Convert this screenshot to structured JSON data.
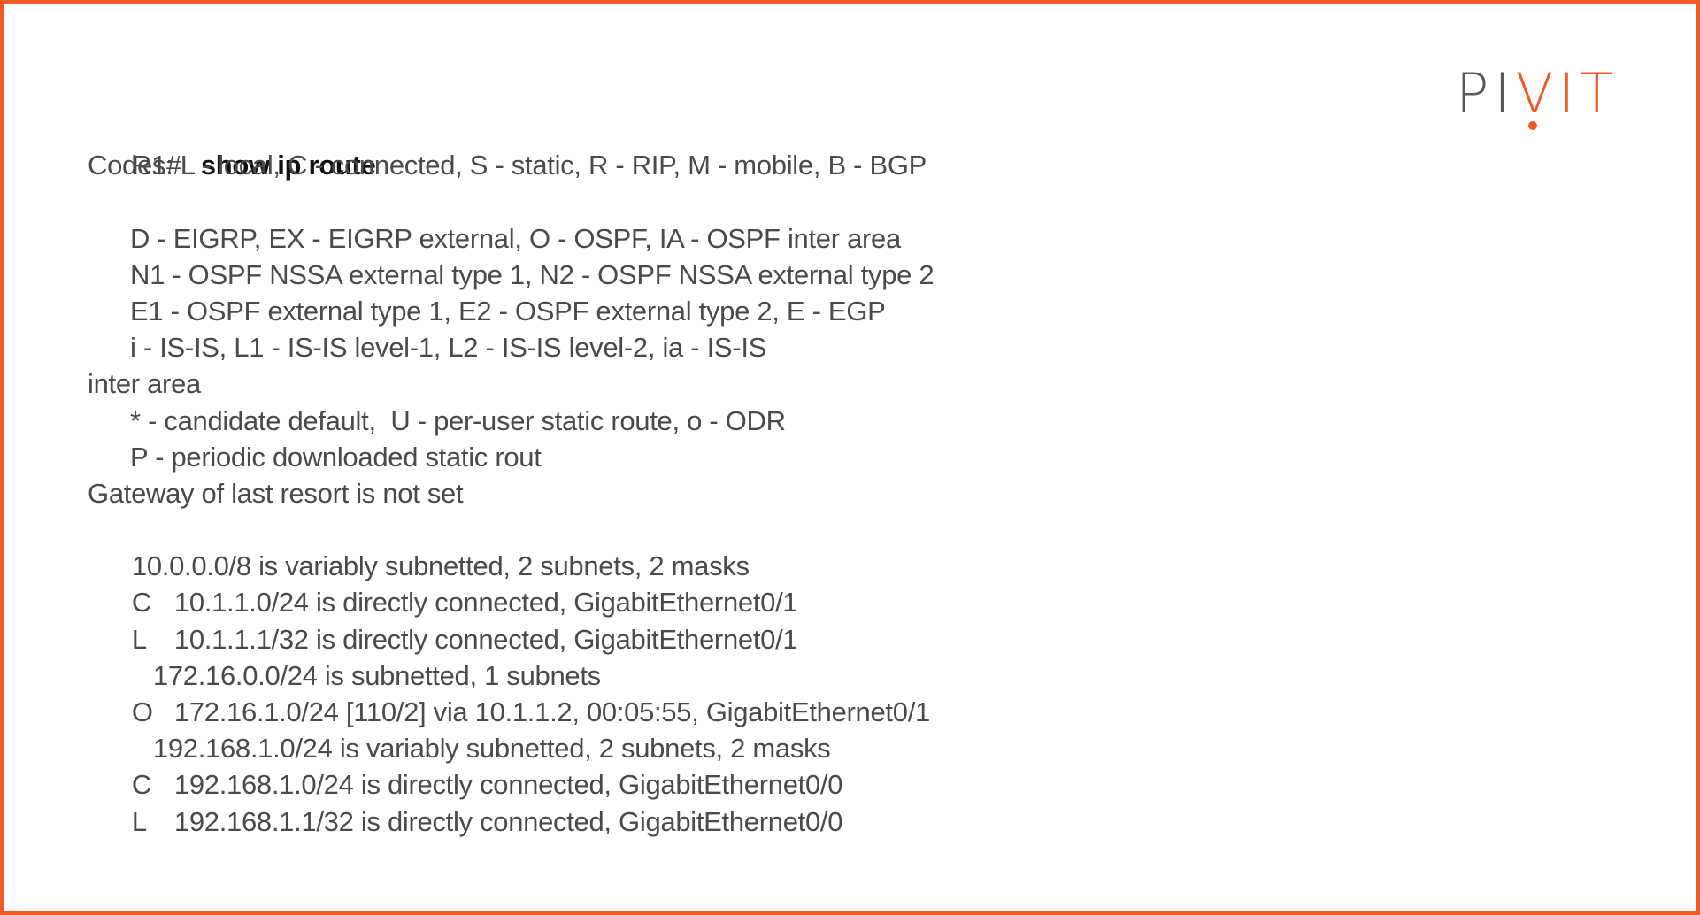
{
  "brand": {
    "logo_left": "PI",
    "logo_v": "V",
    "logo_right": "IT",
    "border_color": "#f05a28",
    "accent_color": "#f05a28",
    "logo_gray": "#58585a"
  },
  "terminal": {
    "prompt": "R1#",
    "command": "show ip route",
    "codes_header": "Codes: L - local, C - connected, S - static, R - RIP, M - mobile, B - BGP",
    "codes_lines": [
      "D - EIGRP, EX - EIGRP external, O - OSPF, IA - OSPF inter area",
      "N1 - OSPF NSSA external type 1, N2 - OSPF NSSA external type 2",
      "E1 - OSPF external type 1, E2 - OSPF external type 2, E - EGP",
      "i - IS-IS, L1 - IS-IS level-1, L2 - IS-IS level-2, ia - IS-IS"
    ],
    "codes_wrap": "inter area",
    "codes_lines_2": [
      "* - candidate default,  U - per-user static route, o - ODR",
      "P - periodic downloaded static rout"
    ],
    "gateway": "Gateway of last resort is not set",
    "routes": [
      {
        "code": "",
        "text": "10.0.0.0/8 is variably subnetted, 2 subnets, 2 masks",
        "indent": "none"
      },
      {
        "code": "C",
        "text": "10.1.1.0/24 is directly connected, GigabitEthernet0/1",
        "indent": "none"
      },
      {
        "code": "L",
        "text": "10.1.1.1/32 is directly connected, GigabitEthernet0/1",
        "indent": "none"
      },
      {
        "code": "",
        "text": "172.16.0.0/24 is subnetted, 1 subnets",
        "indent": "small"
      },
      {
        "code": "O",
        "text": "172.16.1.0/24 [110/2] via 10.1.1.2, 00:05:55, GigabitEthernet0/1",
        "indent": "none"
      },
      {
        "code": "",
        "text": "192.168.1.0/24 is variably subnetted, 2 subnets, 2 masks",
        "indent": "small"
      },
      {
        "code": "C",
        "text": "192.168.1.0/24 is directly connected, GigabitEthernet0/0",
        "indent": "none"
      },
      {
        "code": "L",
        "text": "192.168.1.1/32 is directly connected, GigabitEthernet0/0",
        "indent": "none"
      }
    ]
  }
}
